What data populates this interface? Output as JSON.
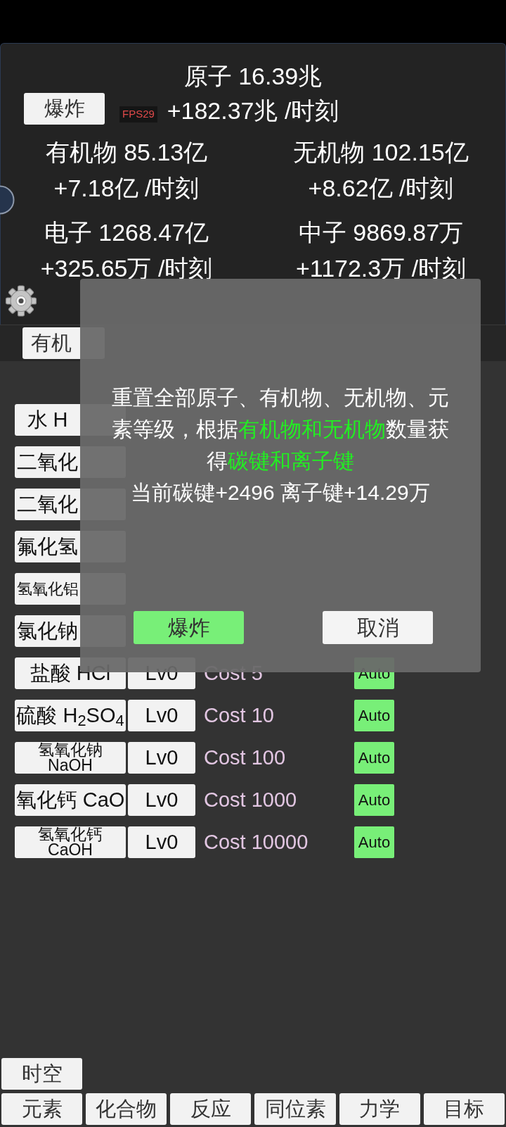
{
  "header": {
    "explode_button": "爆炸",
    "atoms": {
      "amount": "原子 16.39兆",
      "rate": "+182.37兆 /时刻"
    },
    "resources": [
      {
        "amount": "有机物 85.13亿",
        "rate": "+7.18亿 /时刻"
      },
      {
        "amount": "无机物 102.15亿",
        "rate": "+8.62亿 /时刻"
      },
      {
        "amount": "电子 1268.47亿",
        "rate": "+325.65万 /时刻"
      },
      {
        "amount": "中子 9869.87万",
        "rate": "+1172.3万 /时刻"
      }
    ]
  },
  "fps_counter": "FPS29",
  "category_tabs": [
    "有机"
  ],
  "compounds": [
    {
      "name": "水 H"
    },
    {
      "name": "二氧化"
    },
    {
      "name": "二氧化"
    },
    {
      "name": "氟化氢"
    },
    {
      "name": "氢氧化铝"
    },
    {
      "name": "氯化钠"
    },
    {
      "name": "盐酸 HCl",
      "level": "Lv0",
      "cost": "Cost 5",
      "auto": "Auto"
    },
    {
      "name": "硫酸 H$_{2}$SO$_{4}$",
      "level": "Lv0",
      "cost": "Cost 10",
      "auto": "Auto"
    },
    {
      "name": "氢氧化钠 NaOH",
      "level": "Lv0",
      "cost": "Cost 100",
      "auto": "Auto"
    },
    {
      "name": "氧化钙 CaO",
      "level": "Lv0",
      "cost": "Cost 1000",
      "auto": "Auto"
    },
    {
      "name": "氢氧化钙 CaOH",
      "level": "Lv0",
      "cost": "Cost 10000",
      "auto": "Auto"
    }
  ],
  "dialog": {
    "message": [
      {
        "text": "重置全部原子、有机物、无机物、元素等级，根据",
        "highlight": false
      },
      {
        "text": "有机物和无机物",
        "highlight": true
      },
      {
        "text": "数量获得",
        "highlight": false
      },
      {
        "text": "碳键和离子键",
        "highlight": true
      }
    ],
    "summary": "当前碳键+2496 离子键+14.29万",
    "buttons": [
      {
        "label": "爆炸",
        "kind": "confirm"
      },
      {
        "label": "取消",
        "kind": "cancel"
      }
    ]
  },
  "time_space_button": "时空",
  "nav_tabs": [
    "元素",
    "化合物",
    "反应",
    "同位素",
    "力学",
    "目标"
  ]
}
